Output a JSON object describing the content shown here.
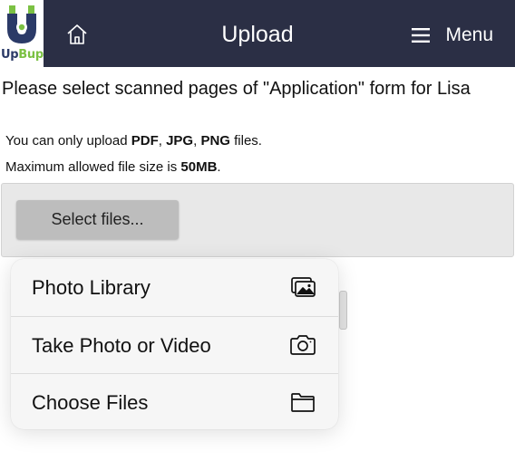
{
  "header": {
    "logo": {
      "up": "Up",
      "bup": "Bup"
    },
    "title": "Upload",
    "menu_label": "Menu",
    "bg_color": "#2b2f45"
  },
  "main": {
    "instruction": "Please select scanned pages of \"Application\" form for Lisa",
    "note1": {
      "prefix": "You can only upload ",
      "t1": "PDF",
      "s1": ", ",
      "t2": "JPG",
      "s2": ", ",
      "t3": "PNG",
      "suffix": " files."
    },
    "note2": {
      "prefix": "Maximum allowed file size is ",
      "size": "50MB",
      "suffix": "."
    },
    "select_button": "Select files..."
  },
  "popup": {
    "items": [
      {
        "label": "Photo Library",
        "icon": "photo-library-icon"
      },
      {
        "label": "Take Photo or Video",
        "icon": "camera-icon"
      },
      {
        "label": "Choose Files",
        "icon": "folder-icon"
      }
    ]
  }
}
